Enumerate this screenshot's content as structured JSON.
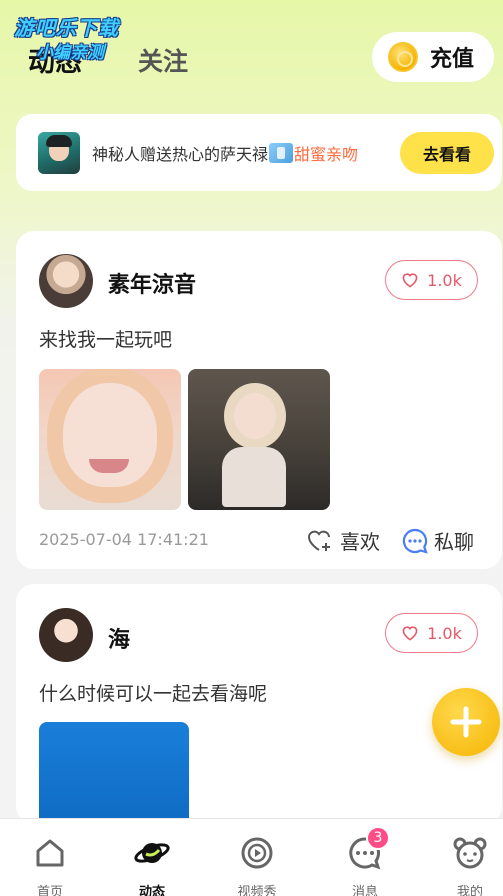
{
  "watermark": {
    "line1": "游吧乐下载",
    "line2": "小编亲测"
  },
  "header": {
    "tabs": [
      {
        "label": "动态",
        "active": true
      },
      {
        "label": "关注",
        "active": false
      }
    ],
    "recharge_label": "充值"
  },
  "notice": {
    "prefix": "神秘人赠送热心的萨天禄",
    "gift_icon": "gift-icon",
    "highlight": "甜蜜亲吻",
    "button_label": "去看看"
  },
  "posts": [
    {
      "username": "素年涼音",
      "likes": "1.0k",
      "text": "来找我一起玩吧",
      "timestamp": "2025-07-04 17:41:21",
      "like_label": "喜欢",
      "chat_label": "私聊"
    },
    {
      "username": "海",
      "likes": "1.0k",
      "text": "什么时候可以一起去看海呢"
    }
  ],
  "tabbar": {
    "items": [
      {
        "label": "首页",
        "icon": "home-icon"
      },
      {
        "label": "动态",
        "icon": "planet-icon",
        "active": true
      },
      {
        "label": "视频秀",
        "icon": "video-play-icon"
      },
      {
        "label": "消息",
        "icon": "message-icon",
        "badge": "3"
      },
      {
        "label": "我的",
        "icon": "bear-icon"
      }
    ]
  },
  "colors": {
    "accent": "#ffe14a",
    "like": "#e65869",
    "chat": "#4a7cf7",
    "badge": "#ff4d88"
  }
}
